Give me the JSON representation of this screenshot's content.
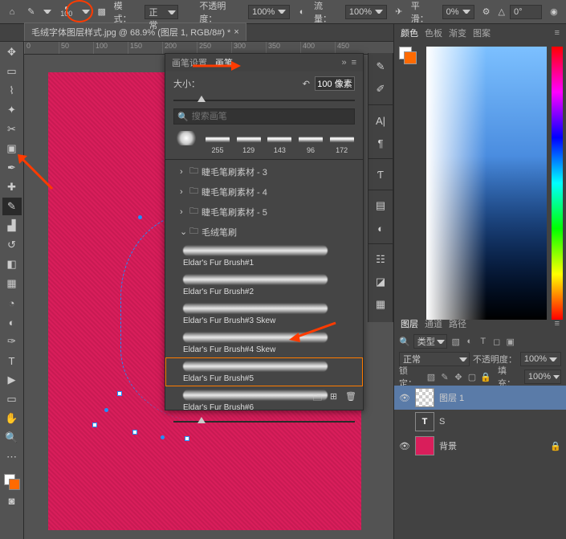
{
  "topbar": {
    "brush_size": "100",
    "mode_label": "模式：",
    "mode_value": "正常",
    "opacity_label": "不透明度：",
    "opacity_value": "100%",
    "flow_label": "流量：",
    "flow_value": "100%",
    "smooth_label": "平滑：",
    "smooth_value": "0%",
    "angle_icon": "△",
    "angle_value": "0°"
  },
  "tab": {
    "title": "毛绒字体图层样式.jpg @ 68.9% (图层 1, RGB/8#) *"
  },
  "ruler": [
    "0",
    "50",
    "100",
    "150",
    "200",
    "250",
    "300",
    "350",
    "400",
    "450"
  ],
  "brush_panel": {
    "tab1": "画笔设置",
    "tab2": "画笔",
    "size_label": "大小：",
    "size_value": "100 像素",
    "search_placeholder": "搜索画笔",
    "thumbs": [
      "255",
      "129",
      "143",
      "96",
      "172"
    ],
    "folders": [
      {
        "name": "睫毛笔刷素材 - 3",
        "open": false
      },
      {
        "name": "睫毛笔刷素材 - 4",
        "open": false
      },
      {
        "name": "睫毛笔刷素材 - 5",
        "open": false
      },
      {
        "name": "毛绒笔刷",
        "open": true
      }
    ],
    "brushes": [
      "Eldar's Fur Brush#1",
      "Eldar's Fur Brush#2",
      "Eldar's Fur Brush#3 Skew",
      "Eldar's Fur Brush#4 Skew",
      "Eldar's Fur Brush#5",
      "Eldar's Fur Brush#6"
    ],
    "selected_index": 4
  },
  "color_panel": {
    "tabs": [
      "颜色",
      "色板",
      "渐变",
      "图案"
    ]
  },
  "layers_panel": {
    "tabs": [
      "图层",
      "通道",
      "路径"
    ],
    "kind_label": "类型",
    "blend": "正常",
    "opacity_label": "不透明度：",
    "opacity": "100%",
    "lock_label": "锁定：",
    "fill_label": "填充：",
    "fill": "100%",
    "layers": [
      {
        "name": "图层 1",
        "type": "pixel"
      },
      {
        "name": "S",
        "type": "text"
      },
      {
        "name": "背景",
        "type": "bg",
        "locked": true
      }
    ]
  }
}
